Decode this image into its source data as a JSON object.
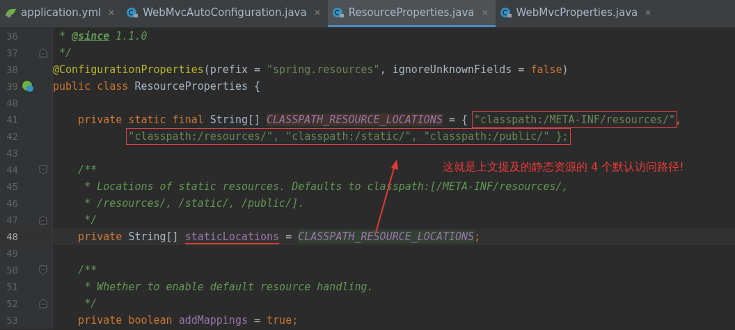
{
  "tabs": [
    {
      "label": "application.yml",
      "kind": "yml",
      "selected": false
    },
    {
      "label": "WebMvcAutoConfiguration.java",
      "kind": "class",
      "selected": false
    },
    {
      "label": "ResourceProperties.java",
      "kind": "class",
      "selected": true
    },
    {
      "label": "WebMvcProperties.java",
      "kind": "class",
      "selected": false
    }
  ],
  "editor": {
    "lines": [
      {
        "number": "36",
        "current": false,
        "tokens": [
          {
            "t": " * ",
            "kind": "comment"
          },
          {
            "t": "@since",
            "kind": "doctag"
          },
          {
            "t": " 1.1.0",
            "kind": "comment"
          }
        ]
      },
      {
        "number": "37",
        "current": false,
        "fold_end": true,
        "tokens": [
          {
            "t": " */",
            "kind": "comment"
          }
        ]
      },
      {
        "number": "38",
        "current": false,
        "tokens": [
          {
            "t": "@ConfigurationProperties",
            "kind": "annotation"
          },
          {
            "t": "(prefix = ",
            "kind": "plain"
          },
          {
            "t": "\"spring.resources\"",
            "kind": "string"
          },
          {
            "t": ", ignoreUnknownFields = ",
            "kind": "plain"
          },
          {
            "t": "false",
            "kind": "keyword"
          },
          {
            "t": ")",
            "kind": "plain"
          }
        ]
      },
      {
        "number": "39",
        "current": false,
        "bean_marker": true,
        "tokens": [
          {
            "t": "public class ",
            "kind": "keyword"
          },
          {
            "t": "ResourceProperties {",
            "kind": "plain"
          }
        ]
      },
      {
        "number": "40",
        "current": false
      },
      {
        "number": "41",
        "current": false,
        "tokens": [
          {
            "t": "    private static final ",
            "kind": "keyword"
          },
          {
            "t": "String[] ",
            "kind": "plain"
          },
          {
            "t": "CLASSPATH_RESOURCE_LOCATIONS",
            "kind": "constant",
            "write_highlight": true
          },
          {
            "t": " = { ",
            "kind": "plain"
          },
          {
            "t": "\"classpath:/META-INF/resources/\"",
            "kind": "string",
            "boxed": true
          },
          {
            "t": ",",
            "kind": "keyword"
          }
        ]
      },
      {
        "number": "42",
        "current": false,
        "continuation": true,
        "tokens": [
          {
            "t": "\"classpath:/resources/\", \"classpath:/static/\", \"classpath:/public/\" };",
            "kind": "string",
            "boxed": true
          }
        ]
      },
      {
        "number": "43",
        "current": false
      },
      {
        "number": "44",
        "current": false,
        "fold_start": true,
        "tokens": [
          {
            "t": "    /**",
            "kind": "comment"
          }
        ]
      },
      {
        "number": "45",
        "current": false,
        "tokens": [
          {
            "t": "     * Locations of static resources. Defaults to classpath:[/META-INF/resources/,",
            "kind": "comment"
          }
        ]
      },
      {
        "number": "46",
        "current": false,
        "tokens": [
          {
            "t": "     * /resources/, /static/, /public/].",
            "kind": "comment"
          }
        ]
      },
      {
        "number": "47",
        "current": false,
        "fold_end": true,
        "tokens": [
          {
            "t": "     */",
            "kind": "comment"
          }
        ]
      },
      {
        "number": "48",
        "current": true,
        "tokens": [
          {
            "t": "    private ",
            "kind": "keyword"
          },
          {
            "t": "String[] ",
            "kind": "plain"
          },
          {
            "t": "staticLocations",
            "kind": "field",
            "underlined": true
          },
          {
            "t": " = ",
            "kind": "plain"
          },
          {
            "t": "CLASSPATH_RESOURCE_LOCATIONS",
            "kind": "constant",
            "read_highlight": true
          },
          {
            "t": ";",
            "kind": "keyword"
          }
        ]
      },
      {
        "number": "49",
        "current": false
      },
      {
        "number": "50",
        "current": false,
        "fold_start": true,
        "tokens": [
          {
            "t": "    /**",
            "kind": "comment"
          }
        ]
      },
      {
        "number": "51",
        "current": false,
        "tokens": [
          {
            "t": "     * Whether to enable default resource handling.",
            "kind": "comment"
          }
        ]
      },
      {
        "number": "52",
        "current": false,
        "fold_end": true,
        "tokens": [
          {
            "t": "     */",
            "kind": "comment"
          }
        ]
      },
      {
        "number": "53",
        "current": false,
        "tokens": [
          {
            "t": "    private boolean ",
            "kind": "keyword"
          },
          {
            "t": "addMappings",
            "kind": "field"
          },
          {
            "t": " = ",
            "kind": "plain"
          },
          {
            "t": "true",
            "kind": "keyword"
          },
          {
            "t": ";",
            "kind": "keyword"
          }
        ]
      }
    ]
  },
  "annotation": {
    "text": "这就是上文提及的静态资源的 4 个默认访问路径!"
  }
}
